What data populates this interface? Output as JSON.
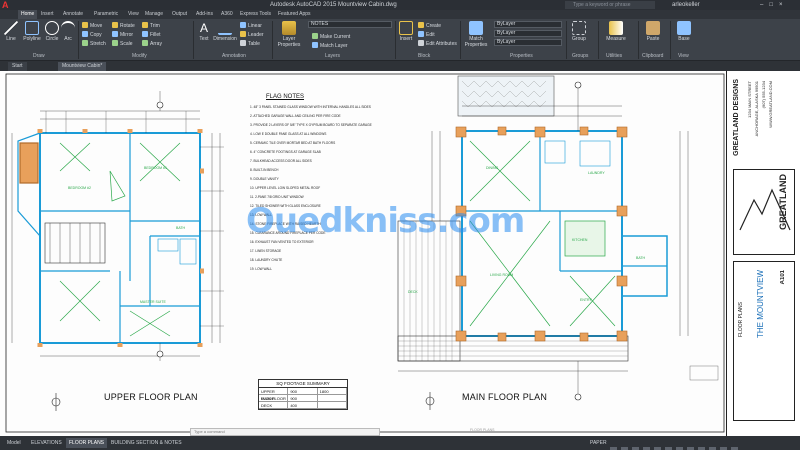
{
  "titlebar": {
    "title": "Autodesk AutoCAD 2015   Mountview Cabin.dwg",
    "search_placeholder": "Type a keyword or phrase",
    "user": "arleokeller"
  },
  "tabs": [
    "Home",
    "Insert",
    "Annotate",
    "Parametric",
    "View",
    "Manage",
    "Output",
    "Add-ins",
    "A360",
    "Express Tools",
    "Featured Apps"
  ],
  "ribbon": {
    "draw": {
      "label": "Draw",
      "line": "Line",
      "polyline": "Polyline",
      "circle": "Circle",
      "arc": "Arc"
    },
    "modify": {
      "label": "Modify",
      "items": [
        "Move",
        "Rotate",
        "Trim",
        "Copy",
        "Mirror",
        "Fillet",
        "Stretch",
        "Scale",
        "Array"
      ]
    },
    "annotation": {
      "label": "Annotation",
      "text": "Text",
      "dimension": "Dimension",
      "table": "Table",
      "linear": "Linear",
      "leader": "Leader"
    },
    "layers": {
      "label": "Layers",
      "layer_properties": "Layer Properties",
      "make_current": "Make Current",
      "match_layer": "Match Layer",
      "current_layer": "NOTES"
    },
    "block": {
      "label": "Block",
      "insert": "Insert",
      "create": "Create",
      "edit": "Edit",
      "edit_attributes": "Edit Attributes"
    },
    "properties": {
      "label": "Properties",
      "match": "Match Properties",
      "bylayer1": "ByLayer",
      "bylayer2": "ByLayer",
      "bylayer3": "ByLayer"
    },
    "groups": {
      "label": "Groups",
      "group": "Group"
    },
    "utilities": {
      "label": "Utilities",
      "measure": "Measure"
    },
    "clipboard": {
      "label": "Clipboard",
      "paste": "Paste"
    },
    "view": {
      "label": "View",
      "base": "Base"
    }
  },
  "filetabs": [
    "Start",
    "Mountview Cabin*"
  ],
  "drawing": {
    "upper_plan_title": "UPPER FLOOR PLAN",
    "main_plan_title": "MAIN FLOOR PLAN",
    "notes_title": "FLAG NOTES",
    "notes": [
      "1. 48\" 3 PANEL STAINED GLASS WINDOW WITH INTERNAL HANDLES ALL SIDES",
      "2. ATTACHED GARAGE WALL AND CEILING PER FIRE CODE",
      "3. PROVIDE 2 LAYERS OF 5/8\" TYPE X GYPSUM BOARD TO SEPARATE GARAGE",
      "4. LOW E DOUBLE PANE GLASS AT ALL WINDOWS",
      "5. CERAMIC TILE OVER MORTAR BED AT BATH FLOORS",
      "6. 4\" CONCRETE FOOTINGS AT GARAGE SLAB",
      "7. BULKHEAD ACCESS DOOR ALL SIDES",
      "8. BUILT-IN BENCH",
      "9. DOUBLE VANITY",
      "10. UPPER LEVEL LOW SLOPED METAL ROOF",
      "11. 2-PANE 7/8 GRID UNIT WINDOW",
      "12. TILED SHOWER WITH GLASS ENCLOSURE",
      "13. LOW WALL",
      "14. STONE FIREPLACE WITH RAISED HEARTH",
      "15. CLEARANCE AROUND FIREPLACE PER CODE",
      "16. EXHAUST FAN VENTED TO EXTERIOR",
      "17. LINEN STORAGE",
      "18. LAUNDRY CHUTE",
      "19. LOW WALL"
    ],
    "sq_footage": {
      "title": "SQ FOOTAGE SUMMARY",
      "rows": [
        [
          "UPPER FLOOR",
          "900",
          "1800"
        ],
        [
          "MAIN FLOOR",
          "900",
          ""
        ],
        [
          "DECK",
          "400",
          ""
        ]
      ]
    },
    "room_labels": {
      "bedroom2": "BEDROOM #2",
      "bedroom1": "BEDROOM #1",
      "bath": "BATH",
      "master": "MASTER SUITE",
      "kitchen": "KITCHEN",
      "living": "LIVING ROOM",
      "dining": "DINING",
      "laundry": "LAUNDRY",
      "bath2": "BATH",
      "entry": "ENTRY",
      "deck": "DECK"
    },
    "sheet_footer": "FLOOR PLANS"
  },
  "watermark": "Ouedkniss.com",
  "titleblock": {
    "company": "GREATLAND DESIGNS",
    "logo": "GREATLAND",
    "project": "THE MOUNTVIEW",
    "subtitle": "FLOOR PLANS",
    "address_lines": [
      "1234 MAIN STREET",
      "ANCHORAGE, ALASKA 99501",
      "(907) 555-1234",
      "WWW.GREATLAND.COM"
    ],
    "sheet_no": "A101"
  },
  "bottombar": {
    "tabs": [
      "Model",
      "ELEVATIONS",
      "FLOOR PLANS",
      "BUILDING SECTION & NOTES"
    ],
    "active_tab": 2,
    "status": "PAPER",
    "command_placeholder": "Type a command"
  }
}
